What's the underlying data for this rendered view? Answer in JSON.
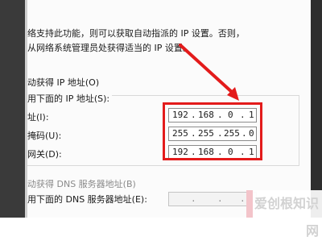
{
  "description": {
    "line1": "络支持此功能，则可以获取自动指派的 IP 设置。否则，",
    "line2": "从网络系统管理员处获得适当的 IP 设置。"
  },
  "ip_section": {
    "auto_option": "动获得 IP 地址(O)",
    "manual_option": "用下面的 IP 地址(S):",
    "fields": [
      {
        "label": "址(I):",
        "octets": [
          "192",
          "168",
          "0",
          "1"
        ]
      },
      {
        "label": "掩码(U):",
        "octets": [
          "255",
          "255",
          "255",
          "0"
        ]
      },
      {
        "label": "网关(D):",
        "octets": [
          "192",
          "168",
          "0",
          "1"
        ]
      }
    ]
  },
  "dns_section": {
    "auto_option": "动获得 DNS 服务器地址(B)",
    "manual_option": "用下面的 DNS 服务器地址(E):"
  },
  "annotation": {
    "color": "#e31b1b"
  },
  "watermark": {
    "text": "爱创根知识网"
  }
}
